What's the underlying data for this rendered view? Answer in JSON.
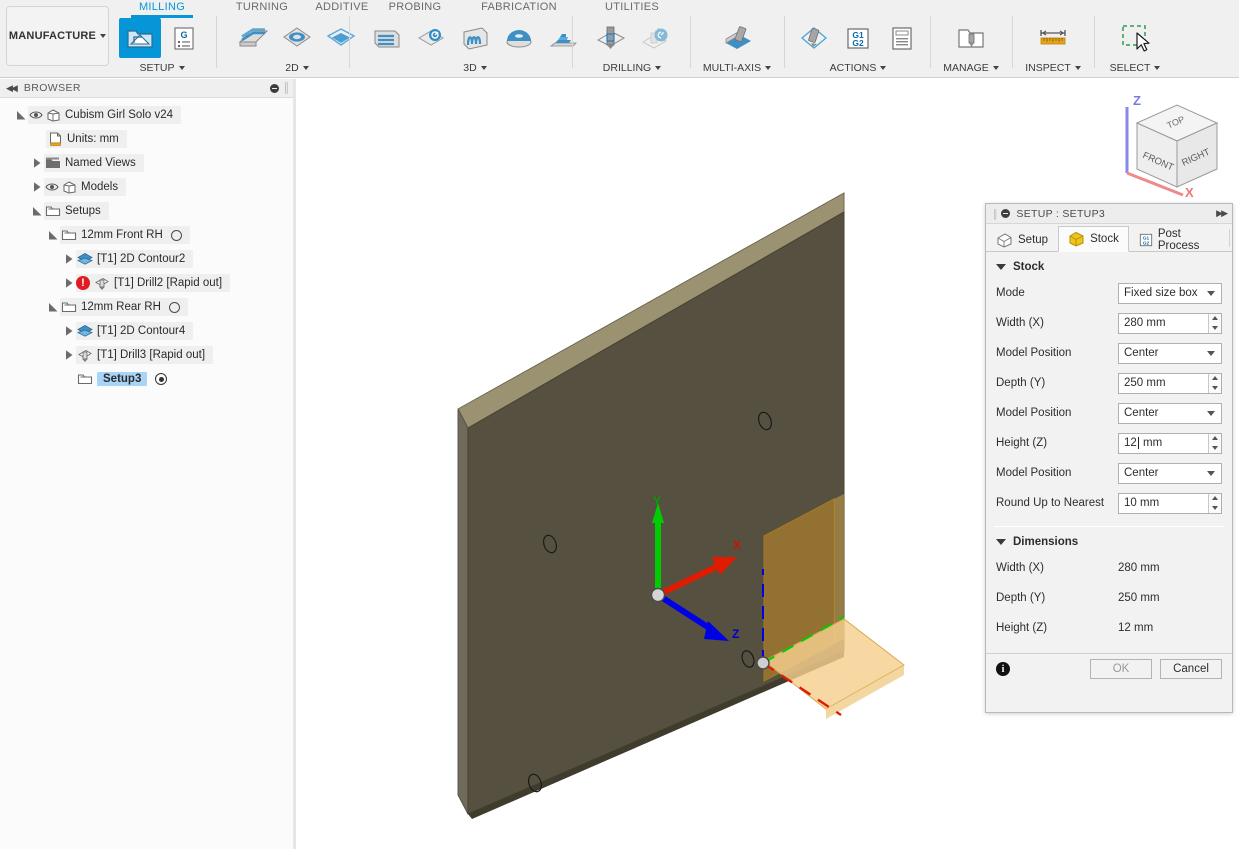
{
  "app": {
    "workspace_label": "MANUFACTURE"
  },
  "ribbon": {
    "tabs": [
      {
        "name": "MILLING",
        "active": true
      },
      {
        "name": "TURNING",
        "active": false
      },
      {
        "name": "ADDITIVE",
        "active": false
      },
      {
        "name": "PROBING",
        "active": false
      },
      {
        "name": "FABRICATION",
        "active": false
      },
      {
        "name": "UTILITIES",
        "active": false
      }
    ],
    "groups": [
      {
        "id": "setup",
        "foot": "SETUP",
        "has_caret": true
      },
      {
        "id": "2d",
        "foot": "2D",
        "has_caret": true
      },
      {
        "id": "3d",
        "foot": "3D",
        "has_caret": true
      },
      {
        "id": "drilling",
        "foot": "DRILLING",
        "has_caret": true
      },
      {
        "id": "multiaxis",
        "foot": "MULTI-AXIS",
        "has_caret": true
      },
      {
        "id": "actions",
        "foot": "ACTIONS",
        "has_caret": true
      },
      {
        "id": "manage",
        "foot": "MANAGE",
        "has_caret": true
      },
      {
        "id": "inspect",
        "foot": "INSPECT",
        "has_caret": true
      },
      {
        "id": "select",
        "foot": "SELECT",
        "has_caret": true
      }
    ]
  },
  "browser": {
    "title": "BROWSER",
    "tree": [
      {
        "label": "Cubism Girl Solo v24",
        "indent": 0,
        "toggle": "open",
        "eye": true,
        "icon": "component-icon"
      },
      {
        "label": "Units: mm",
        "indent": 1,
        "toggle": "none",
        "eye": false,
        "icon": "units-document-icon"
      },
      {
        "label": "Named Views",
        "indent": 1,
        "toggle": "closed",
        "eye": false,
        "icon": "folder-views-icon"
      },
      {
        "label": "Models",
        "indent": 1,
        "toggle": "closed",
        "eye": true,
        "icon": "component-icon"
      },
      {
        "label": "Setups",
        "indent": 1,
        "toggle": "open",
        "eye": false,
        "icon": "setup-folder-icon"
      },
      {
        "label": "12mm Front RH",
        "indent": 2,
        "toggle": "open",
        "eye": false,
        "icon": "setup-folder-icon",
        "suffix": "circle-empty"
      },
      {
        "label": "[T1] 2D Contour2",
        "indent": 3,
        "toggle": "closed",
        "eye": false,
        "icon": "contour2d-icon"
      },
      {
        "label": "[T1] Drill2 [Rapid out]",
        "indent": 3,
        "toggle": "closed",
        "eye": false,
        "icon": "drill-icon",
        "error": true
      },
      {
        "label": "12mm Rear RH",
        "indent": 2,
        "toggle": "open",
        "eye": false,
        "icon": "setup-folder-icon",
        "suffix": "circle-empty"
      },
      {
        "label": "[T1] 2D Contour4",
        "indent": 3,
        "toggle": "closed",
        "eye": false,
        "icon": "contour2d-icon"
      },
      {
        "label": "[T1] Drill3 [Rapid out]",
        "indent": 3,
        "toggle": "closed",
        "eye": false,
        "icon": "drill-icon"
      },
      {
        "label": "Setup3",
        "indent": 3,
        "toggle": "none",
        "eye": false,
        "icon": "setup-folder-icon",
        "selected": true,
        "suffix": "circle-dot"
      }
    ]
  },
  "viewport": {
    "viewcube": {
      "top": "TOP",
      "front": "FRONT",
      "right": "RIGHT",
      "axis_z": "Z",
      "axis_x": "X"
    },
    "wcs_labels": {
      "x": "X",
      "y": "Y",
      "z": "Z"
    },
    "colors": {
      "model_face": "#55503f",
      "model_top": "#938a68",
      "model_side": "#6b6758",
      "stock_amber": "#d9a333",
      "axis_x": "#e01b00",
      "axis_y": "#00cc00",
      "axis_z": "#0000e6"
    }
  },
  "dialog": {
    "title": "SETUP : SETUP3",
    "tabs": [
      {
        "label": "Setup",
        "icon": "setup-icon",
        "active": false
      },
      {
        "label": "Stock",
        "icon": "stock-box-icon",
        "active": true
      },
      {
        "label": "Post Process",
        "icon": "g-code-icon",
        "active": false
      }
    ],
    "stock_section": {
      "title": "Stock",
      "fields": [
        {
          "label": "Mode",
          "type": "select",
          "value": "Fixed size box"
        },
        {
          "label": "Width (X)",
          "type": "spin",
          "value": "280 mm"
        },
        {
          "label": "Model Position",
          "type": "select",
          "value": "Center"
        },
        {
          "label": "Depth (Y)",
          "type": "spin",
          "value": "250 mm"
        },
        {
          "label": "Model Position",
          "type": "select",
          "value": "Center"
        },
        {
          "label": "Height (Z)",
          "type": "spin",
          "value": "12 mm",
          "cursor_after": "12",
          "focused": true
        },
        {
          "label": "Model Position",
          "type": "select",
          "value": "Center"
        },
        {
          "label": "Round Up to Nearest",
          "type": "spin",
          "value": "10 mm"
        }
      ]
    },
    "dimensions_section": {
      "title": "Dimensions",
      "rows": [
        {
          "label": "Width (X)",
          "value": "280 mm"
        },
        {
          "label": "Depth (Y)",
          "value": "250 mm"
        },
        {
          "label": "Height (Z)",
          "value": "12 mm"
        }
      ]
    },
    "footer": {
      "ok_label": "OK",
      "cancel_label": "Cancel",
      "info_icon": "info-icon"
    }
  }
}
